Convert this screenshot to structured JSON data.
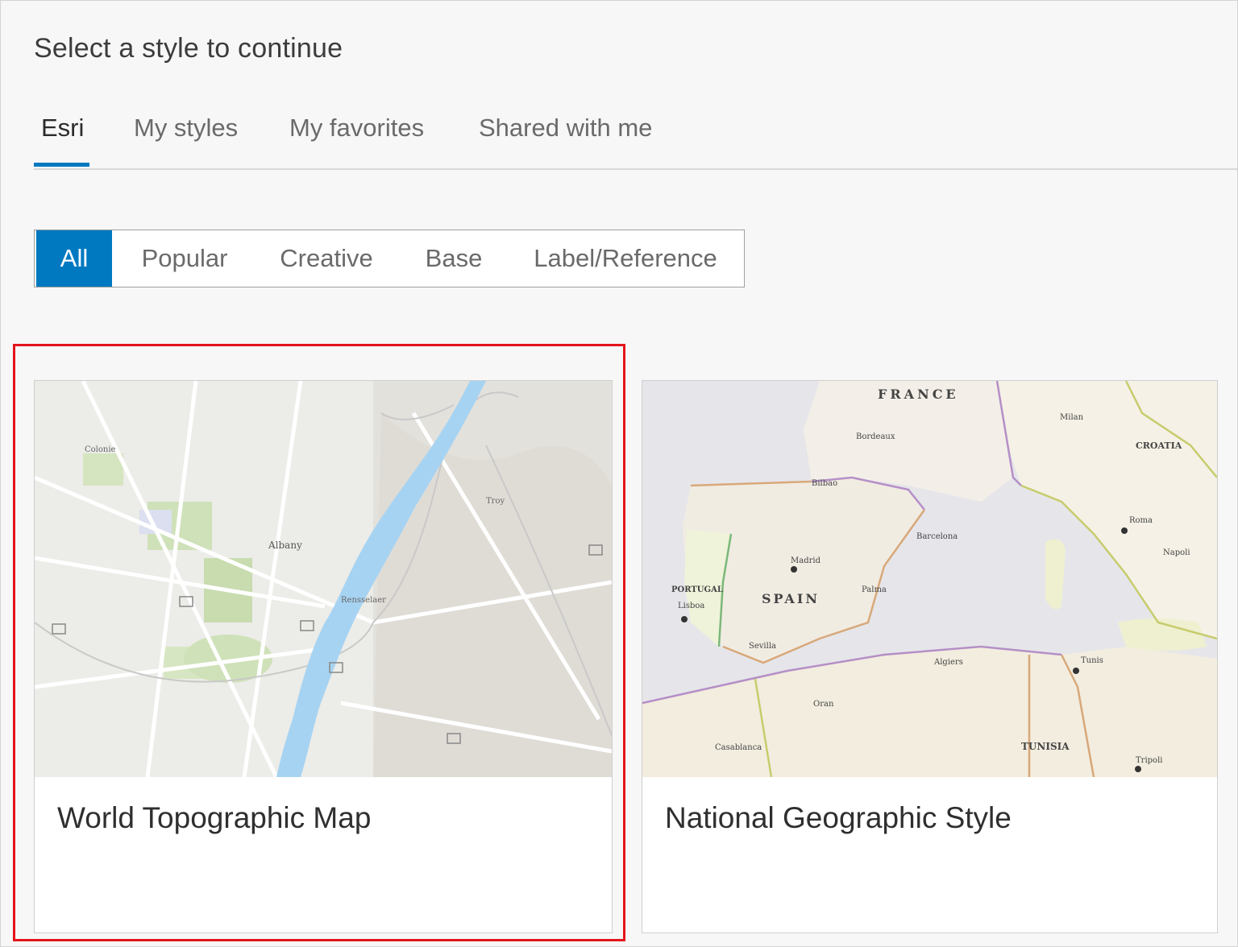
{
  "dialog": {
    "title": "Select a style to continue"
  },
  "tabs": [
    {
      "label": "Esri",
      "active": true
    },
    {
      "label": "My styles",
      "active": false
    },
    {
      "label": "My favorites",
      "active": false
    },
    {
      "label": "Shared with me",
      "active": false
    }
  ],
  "filters": [
    {
      "label": "All",
      "active": true
    },
    {
      "label": "Popular",
      "active": false
    },
    {
      "label": "Creative",
      "active": false
    },
    {
      "label": "Base",
      "active": false
    },
    {
      "label": "Label/Reference",
      "active": false
    }
  ],
  "cards": [
    {
      "name": "World Topographic Map",
      "selected": true,
      "thumb_labels": [
        "Albany",
        "Rensselaer",
        "Troy",
        "Colonie"
      ]
    },
    {
      "name": "National Geographic Style",
      "selected": false,
      "thumb_labels": [
        "FRANCE",
        "SPAIN",
        "PORTUGAL",
        "CROATIA",
        "TUNISIA",
        "Barcelona",
        "Lisboa",
        "Roma",
        "Milan",
        "Napoli",
        "Madrid",
        "Sevilla",
        "Algiers",
        "Tunis",
        "Casablanca",
        "Bordeaux",
        "Tripoli",
        "Bilbao",
        "Palma",
        "Oran"
      ]
    }
  ],
  "colors": {
    "accent": "#0079c1",
    "selection_outline": "#e4141b"
  }
}
